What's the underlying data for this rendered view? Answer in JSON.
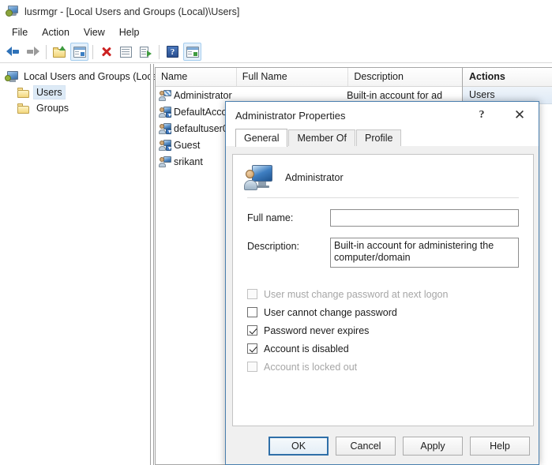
{
  "window": {
    "title": "lusrmgr - [Local Users and Groups (Local)\\Users]",
    "icon": "mmc-console-icon"
  },
  "menubar": {
    "items": [
      {
        "label": "File"
      },
      {
        "label": "Action"
      },
      {
        "label": "View"
      },
      {
        "label": "Help"
      }
    ]
  },
  "toolbar": {
    "buttons": [
      {
        "name": "back-icon",
        "title": "Back"
      },
      {
        "name": "forward-icon",
        "title": "Forward"
      },
      {
        "name": "up-one-level-icon",
        "title": "Up One Level"
      },
      {
        "name": "show-hide-console-tree-icon",
        "title": "Show/Hide Console Tree"
      },
      {
        "name": "delete-icon",
        "title": "Delete"
      },
      {
        "name": "properties-icon",
        "title": "Properties"
      },
      {
        "name": "export-list-icon",
        "title": "Export List"
      },
      {
        "name": "help-icon",
        "title": "Help"
      },
      {
        "name": "show-hide-action-pane-icon",
        "title": "Show/Hide Action Pane"
      }
    ],
    "help_glyph": "?"
  },
  "tree": {
    "root": {
      "label": "Local Users and Groups (Local)",
      "icon": "computer-icon"
    },
    "children": [
      {
        "label": "Users",
        "icon": "folder-icon",
        "selected": true
      },
      {
        "label": "Groups",
        "icon": "folder-icon",
        "selected": false
      }
    ]
  },
  "list": {
    "columns": [
      {
        "label": "Name"
      },
      {
        "label": "Full Name"
      },
      {
        "label": "Description"
      }
    ],
    "rows": [
      {
        "name": "Administrator",
        "full_name": "",
        "description": "Built-in account for ad",
        "icon": "user-admin-icon"
      },
      {
        "name": "DefaultAcco",
        "full_name": "",
        "description": "",
        "icon": "user-icon"
      },
      {
        "name": "defaultuser0",
        "full_name": "",
        "description": "",
        "icon": "user-icon"
      },
      {
        "name": "Guest",
        "full_name": "",
        "description": "",
        "icon": "user-icon"
      },
      {
        "name": "srikant",
        "full_name": "",
        "description": "",
        "icon": "user-icon"
      }
    ]
  },
  "actions": {
    "title": "Actions",
    "subtitle": "Users"
  },
  "dialog": {
    "title": "Administrator Properties",
    "help_button": "?",
    "close_button": "✕",
    "tabs": [
      {
        "label": "General",
        "active": true
      },
      {
        "label": "Member Of",
        "active": false
      },
      {
        "label": "Profile",
        "active": false
      }
    ],
    "account_name": "Administrator",
    "account_icon": "user-large-icon",
    "fields": [
      {
        "label": "Full name:",
        "value": "",
        "placeholder": ""
      },
      {
        "label": "Description:",
        "value": "Built-in account for administering the computer/domain",
        "placeholder": ""
      }
    ],
    "checkboxes": [
      {
        "label": "User must change password at next logon",
        "checked": false,
        "disabled": true
      },
      {
        "label": "User cannot change password",
        "checked": false,
        "disabled": false
      },
      {
        "label": "Password never expires",
        "checked": true,
        "disabled": false
      },
      {
        "label": "Account is disabled",
        "checked": true,
        "disabled": false
      },
      {
        "label": "Account is locked out",
        "checked": false,
        "disabled": true
      }
    ],
    "buttons": [
      {
        "label": "OK",
        "default": true
      },
      {
        "label": "Cancel",
        "default": false
      },
      {
        "label": "Apply",
        "default": false
      },
      {
        "label": "Help",
        "default": false
      }
    ]
  },
  "colors": {
    "dialog_border": "#4a7fae",
    "default_button_border": "#2f6fa8",
    "selection": "#ddeaf6",
    "actions_subtitle_bg": "#dfeaf6"
  }
}
